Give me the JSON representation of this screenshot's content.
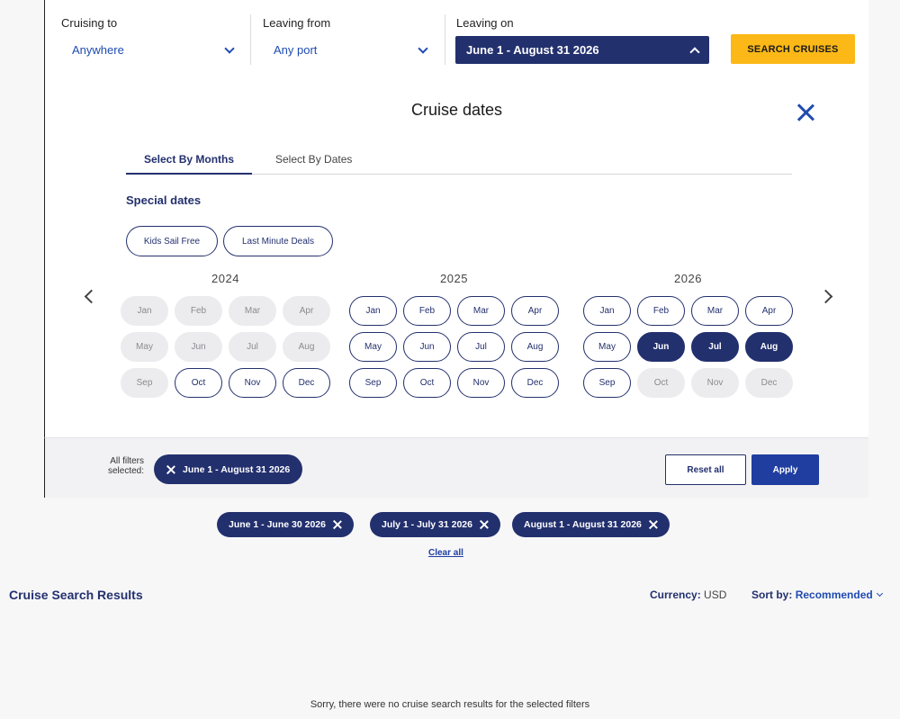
{
  "search": {
    "cruising_to_label": "Cruising to",
    "cruising_to_value": "Anywhere",
    "leaving_from_label": "Leaving from",
    "leaving_from_value": "Any port",
    "leaving_on_label": "Leaving on",
    "leaving_on_value": "June 1 - August 31 2026",
    "search_button": "SEARCH CRUISES",
    "colors": {
      "accent": "#fbb817",
      "primary": "#23306e",
      "link": "#1f4bb1"
    }
  },
  "panel": {
    "title": "Cruise dates",
    "tabs": [
      "Select By Months",
      "Select By Dates"
    ],
    "special_title": "Special dates",
    "special_dates": [
      "Kids Sail Free",
      "Last Minute Deals"
    ],
    "years": [
      {
        "year": "2024",
        "months": [
          {
            "label": "Jan",
            "state": "disabled"
          },
          {
            "label": "Feb",
            "state": "disabled"
          },
          {
            "label": "Mar",
            "state": "disabled"
          },
          {
            "label": "Apr",
            "state": "disabled"
          },
          {
            "label": "May",
            "state": "disabled"
          },
          {
            "label": "Jun",
            "state": "disabled"
          },
          {
            "label": "Jul",
            "state": "disabled"
          },
          {
            "label": "Aug",
            "state": "disabled"
          },
          {
            "label": "Sep",
            "state": "disabled"
          },
          {
            "label": "Oct",
            "state": "available"
          },
          {
            "label": "Nov",
            "state": "available"
          },
          {
            "label": "Dec",
            "state": "available"
          }
        ]
      },
      {
        "year": "2025",
        "months": [
          {
            "label": "Jan",
            "state": "available"
          },
          {
            "label": "Feb",
            "state": "available"
          },
          {
            "label": "Mar",
            "state": "available"
          },
          {
            "label": "Apr",
            "state": "available"
          },
          {
            "label": "May",
            "state": "available"
          },
          {
            "label": "Jun",
            "state": "available"
          },
          {
            "label": "Jul",
            "state": "available"
          },
          {
            "label": "Aug",
            "state": "available"
          },
          {
            "label": "Sep",
            "state": "available"
          },
          {
            "label": "Oct",
            "state": "available"
          },
          {
            "label": "Nov",
            "state": "available"
          },
          {
            "label": "Dec",
            "state": "available"
          }
        ]
      },
      {
        "year": "2026",
        "months": [
          {
            "label": "Jan",
            "state": "available"
          },
          {
            "label": "Feb",
            "state": "available"
          },
          {
            "label": "Mar",
            "state": "available"
          },
          {
            "label": "Apr",
            "state": "available"
          },
          {
            "label": "May",
            "state": "available"
          },
          {
            "label": "Jun",
            "state": "selected"
          },
          {
            "label": "Jul",
            "state": "selected"
          },
          {
            "label": "Aug",
            "state": "selected"
          },
          {
            "label": "Sep",
            "state": "available"
          },
          {
            "label": "Oct",
            "state": "disabled"
          },
          {
            "label": "Nov",
            "state": "disabled"
          },
          {
            "label": "Dec",
            "state": "disabled"
          }
        ]
      }
    ]
  },
  "filters": {
    "label": "All filters selected:",
    "chip": "June 1 - August 31 2026",
    "reset": "Reset all",
    "apply": "Apply"
  },
  "active_filters": [
    "June 1 - June 30 2026",
    "July 1 - July 31 2026",
    "August 1 - August 31 2026"
  ],
  "clear_all": "Clear all",
  "results": {
    "title": "Cruise Search Results",
    "currency_label": "Currency:",
    "currency_value": "USD",
    "sort_label": "Sort by:",
    "sort_value": "Recommended",
    "empty_message": "Sorry, there were no cruise search results for the selected filters"
  }
}
